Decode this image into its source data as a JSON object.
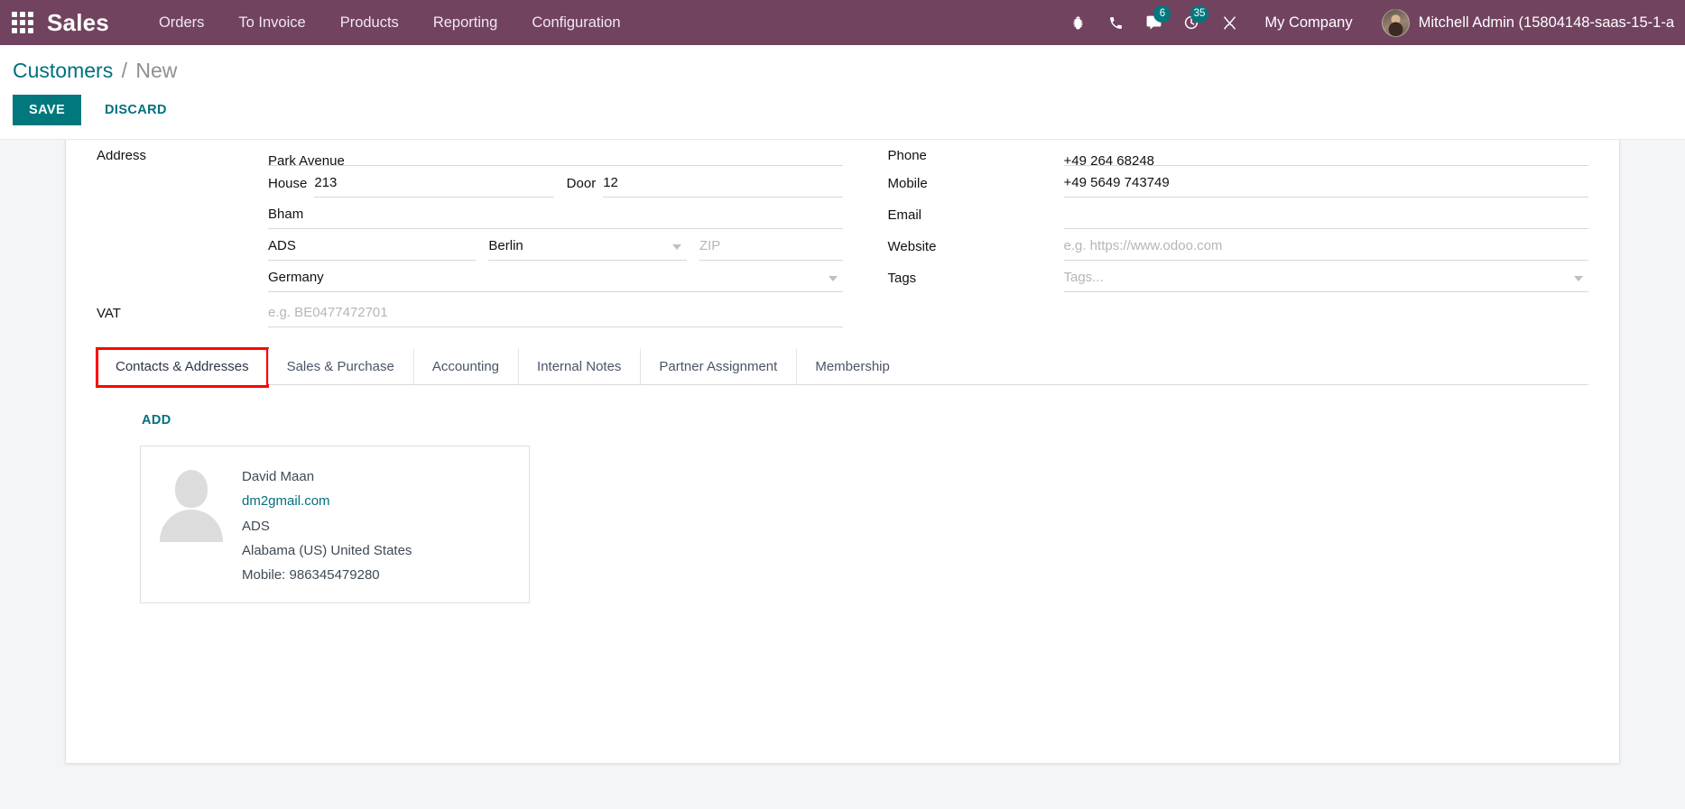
{
  "navbar": {
    "apps_icon": "apps-grid-icon",
    "brand": "Sales",
    "menu_items": [
      {
        "label": "Orders"
      },
      {
        "label": "To Invoice"
      },
      {
        "label": "Products"
      },
      {
        "label": "Reporting"
      },
      {
        "label": "Configuration"
      }
    ],
    "system_icons": [
      {
        "name": "bug-icon",
        "badge": ""
      },
      {
        "name": "phone-icon",
        "badge": ""
      },
      {
        "name": "messages-icon",
        "badge": "6"
      },
      {
        "name": "activities-clock-icon",
        "badge": "35"
      },
      {
        "name": "tools-wrench-icon",
        "badge": ""
      }
    ],
    "company": "My Company",
    "user": "Mitchell Admin (15804148-saas-15-1-a",
    "avatar": "user-avatar"
  },
  "breadcrumb": {
    "root": "Customers",
    "separator": "/",
    "current": "New"
  },
  "actions": {
    "save": "SAVE",
    "discard": "DISCARD"
  },
  "form": {
    "left": {
      "address_label": "Address",
      "street": "Park Avenue",
      "house_label": "House",
      "house": "213",
      "door_label": "Door",
      "door": "12",
      "street2": "Bham",
      "city": "ADS",
      "state": "Berlin",
      "zip_placeholder": "ZIP",
      "country": "Germany",
      "vat_label": "VAT",
      "vat_placeholder": "e.g. BE0477472701"
    },
    "right": {
      "phone_label": "Phone",
      "phone": "+49 264 68248",
      "mobile_label": "Mobile",
      "mobile": "+49 5649 743749",
      "email_label": "Email",
      "email": "",
      "website_label": "Website",
      "website_placeholder": "e.g. https://www.odoo.com",
      "tags_label": "Tags",
      "tags_placeholder": "Tags..."
    }
  },
  "tabs": [
    {
      "label": "Contacts & Addresses",
      "active": true,
      "highlighted": true
    },
    {
      "label": "Sales & Purchase",
      "active": false,
      "highlighted": false
    },
    {
      "label": "Accounting",
      "active": false,
      "highlighted": false
    },
    {
      "label": "Internal Notes",
      "active": false,
      "highlighted": false
    },
    {
      "label": "Partner Assignment",
      "active": false,
      "highlighted": false
    },
    {
      "label": "Membership",
      "active": false,
      "highlighted": false
    }
  ],
  "tab_panel": {
    "add_label": "ADD",
    "contacts": [
      {
        "name": "David Maan",
        "email": "dm2gmail.com",
        "city": "ADS",
        "location": "Alabama (US) United States",
        "mobile": "Mobile: 986345479280"
      }
    ]
  },
  "colors": {
    "navbar_bg": "#71435f",
    "accent_teal": "#00787d",
    "link_teal": "#00707f",
    "highlight_red": "#ff0000",
    "badge_bg": "#00787d"
  }
}
